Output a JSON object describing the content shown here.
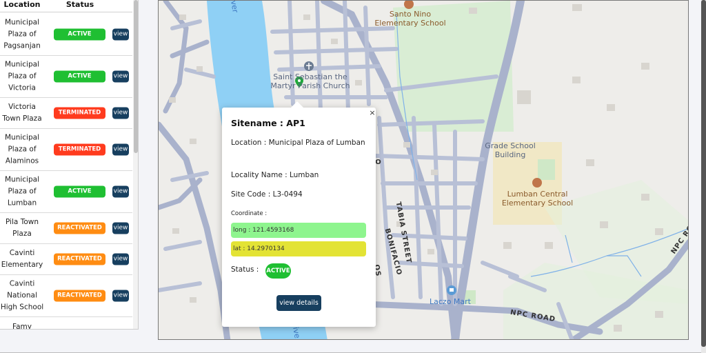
{
  "table": {
    "header": {
      "location": "Location",
      "status": "Status"
    },
    "rows": [
      {
        "location": "Municipal Plaza of Pagsanjan",
        "status": "ACTIVE",
        "kind": "active",
        "action": "view"
      },
      {
        "location": "Municipal Plaza of Victoria",
        "status": "ACTIVE",
        "kind": "active",
        "action": "view"
      },
      {
        "location": "Victoria Town Plaza",
        "status": "TERMINATED",
        "kind": "term",
        "action": "view"
      },
      {
        "location": "Municipal Plaza of Alaminos",
        "status": "TERMINATED",
        "kind": "term",
        "action": "view"
      },
      {
        "location": "Municipal Plaza of Lumban",
        "status": "ACTIVE",
        "kind": "active",
        "action": "view"
      },
      {
        "location": "Pila Town Plaza",
        "status": "REACTIVATED",
        "kind": "react",
        "action": "view"
      },
      {
        "location": "Cavinti Elementary",
        "status": "REACTIVATED",
        "kind": "react",
        "action": "view"
      },
      {
        "location": "Cavinti National High School",
        "status": "REACTIVATED",
        "kind": "react",
        "action": "view"
      },
      {
        "location": "Famy",
        "status": "",
        "kind": "",
        "action": ""
      }
    ]
  },
  "map": {
    "labels": {
      "santo_nino": "Santo Nino Elementary School",
      "saint_sebastian": "Saint Sebastian the Martyr Parish Church",
      "grade_school": "Grade School Building",
      "lumban_central": "Lumban Central Elementary School",
      "lazco_mart": "Laczo Mart",
      "river": "ver",
      "river_bottom": "ive",
      "tabia_street": "TABIA STREET",
      "bonifacio": "BONIFACIO",
      "bonifacio_partial": "O",
      "bonifacio_tail": "OS",
      "npc_road_1": "NPC ROAD",
      "npc_road_2": "NPC RO"
    }
  },
  "popup": {
    "close": "×",
    "sitename": "Sitename : AP1",
    "location": "Location : Municipal Plaza of Lumban",
    "locality": "Locality Name : Lumban",
    "site_code": "Site Code : L3-0494",
    "coordinate_label": "Coordinate :",
    "long": "long : 121.4593168",
    "lat": "lat : 14.2970134",
    "status_label": "Status :",
    "status": "ACTIVE",
    "button": "view details"
  },
  "colors": {
    "active": "#1fbf32",
    "terminated": "#ff3b1e",
    "reactivated": "#ff8c12",
    "view_button": "#173f5f",
    "long_bg": "#8ef58e",
    "lat_bg": "#e3e335",
    "water": "#8fd0f5",
    "park": "#d4ecd0"
  }
}
